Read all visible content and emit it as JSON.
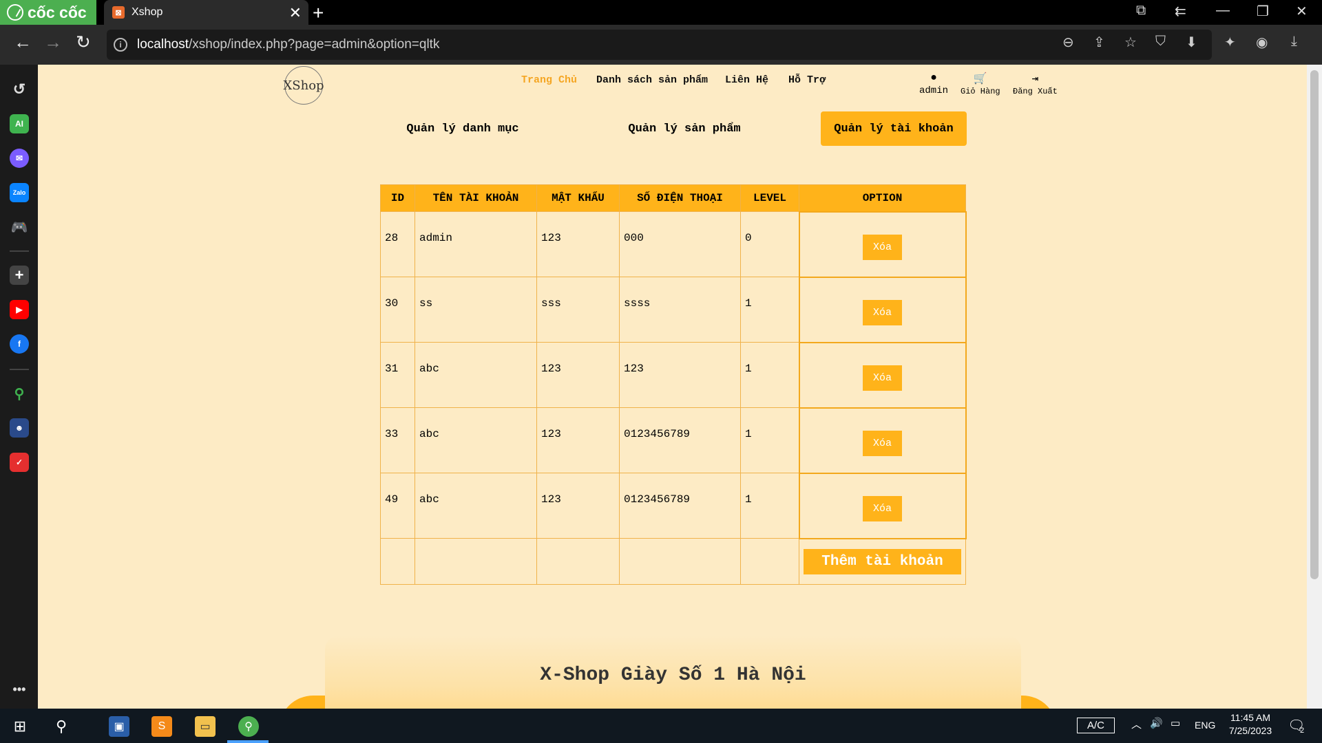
{
  "browser": {
    "brand": "cốc cốc",
    "tab_title": "Xshop",
    "url_host": "localhost",
    "url_path": "/xshop/index.php?page=admin&option=qltk"
  },
  "site": {
    "logo": "XShop",
    "nav": [
      "Trang Chủ",
      "Danh sách sản phẩm",
      "Liên Hệ",
      "Hỗ Trợ"
    ],
    "user": "admin",
    "cart": "Giỏ Hàng",
    "logout": "Đăng Xuất"
  },
  "admin_tabs": [
    "Quản lý danh mục",
    "Quản lý sản phẩm",
    "Quản lý tài khoản"
  ],
  "table": {
    "headers": [
      "ID",
      "TÊN TÀI KHOẢN",
      "MẬT KHẨU",
      "SỐ ĐIỆN THOẠI",
      "LEVEL",
      "OPTION"
    ],
    "rows": [
      {
        "id": "28",
        "name": "admin",
        "password": "123",
        "phone": "000",
        "level": "0",
        "action": "Xóa"
      },
      {
        "id": "30",
        "name": "ss",
        "password": "sss",
        "phone": "ssss",
        "level": "1",
        "action": "Xóa"
      },
      {
        "id": "31",
        "name": "abc",
        "password": "123",
        "phone": "123",
        "level": "1",
        "action": "Xóa"
      },
      {
        "id": "33",
        "name": "abc",
        "password": "123",
        "phone": "0123456789",
        "level": "1",
        "action": "Xóa"
      },
      {
        "id": "49",
        "name": "abc",
        "password": "123",
        "phone": "0123456789",
        "level": "1",
        "action": "Xóa"
      }
    ],
    "add_button": "Thêm tài khoản"
  },
  "footer_title": "X-Shop Giày Số 1 Hà Nội",
  "taskbar": {
    "ac_label": "A/C",
    "lang": "ENG",
    "time": "11:45 AM",
    "date": "7/25/2023",
    "notifications": "2"
  },
  "colors": {
    "accent": "#ffb31a",
    "page_bg": "#fdebc5",
    "active_nav": "#f5a623",
    "coccoc_green": "#4caf50"
  }
}
